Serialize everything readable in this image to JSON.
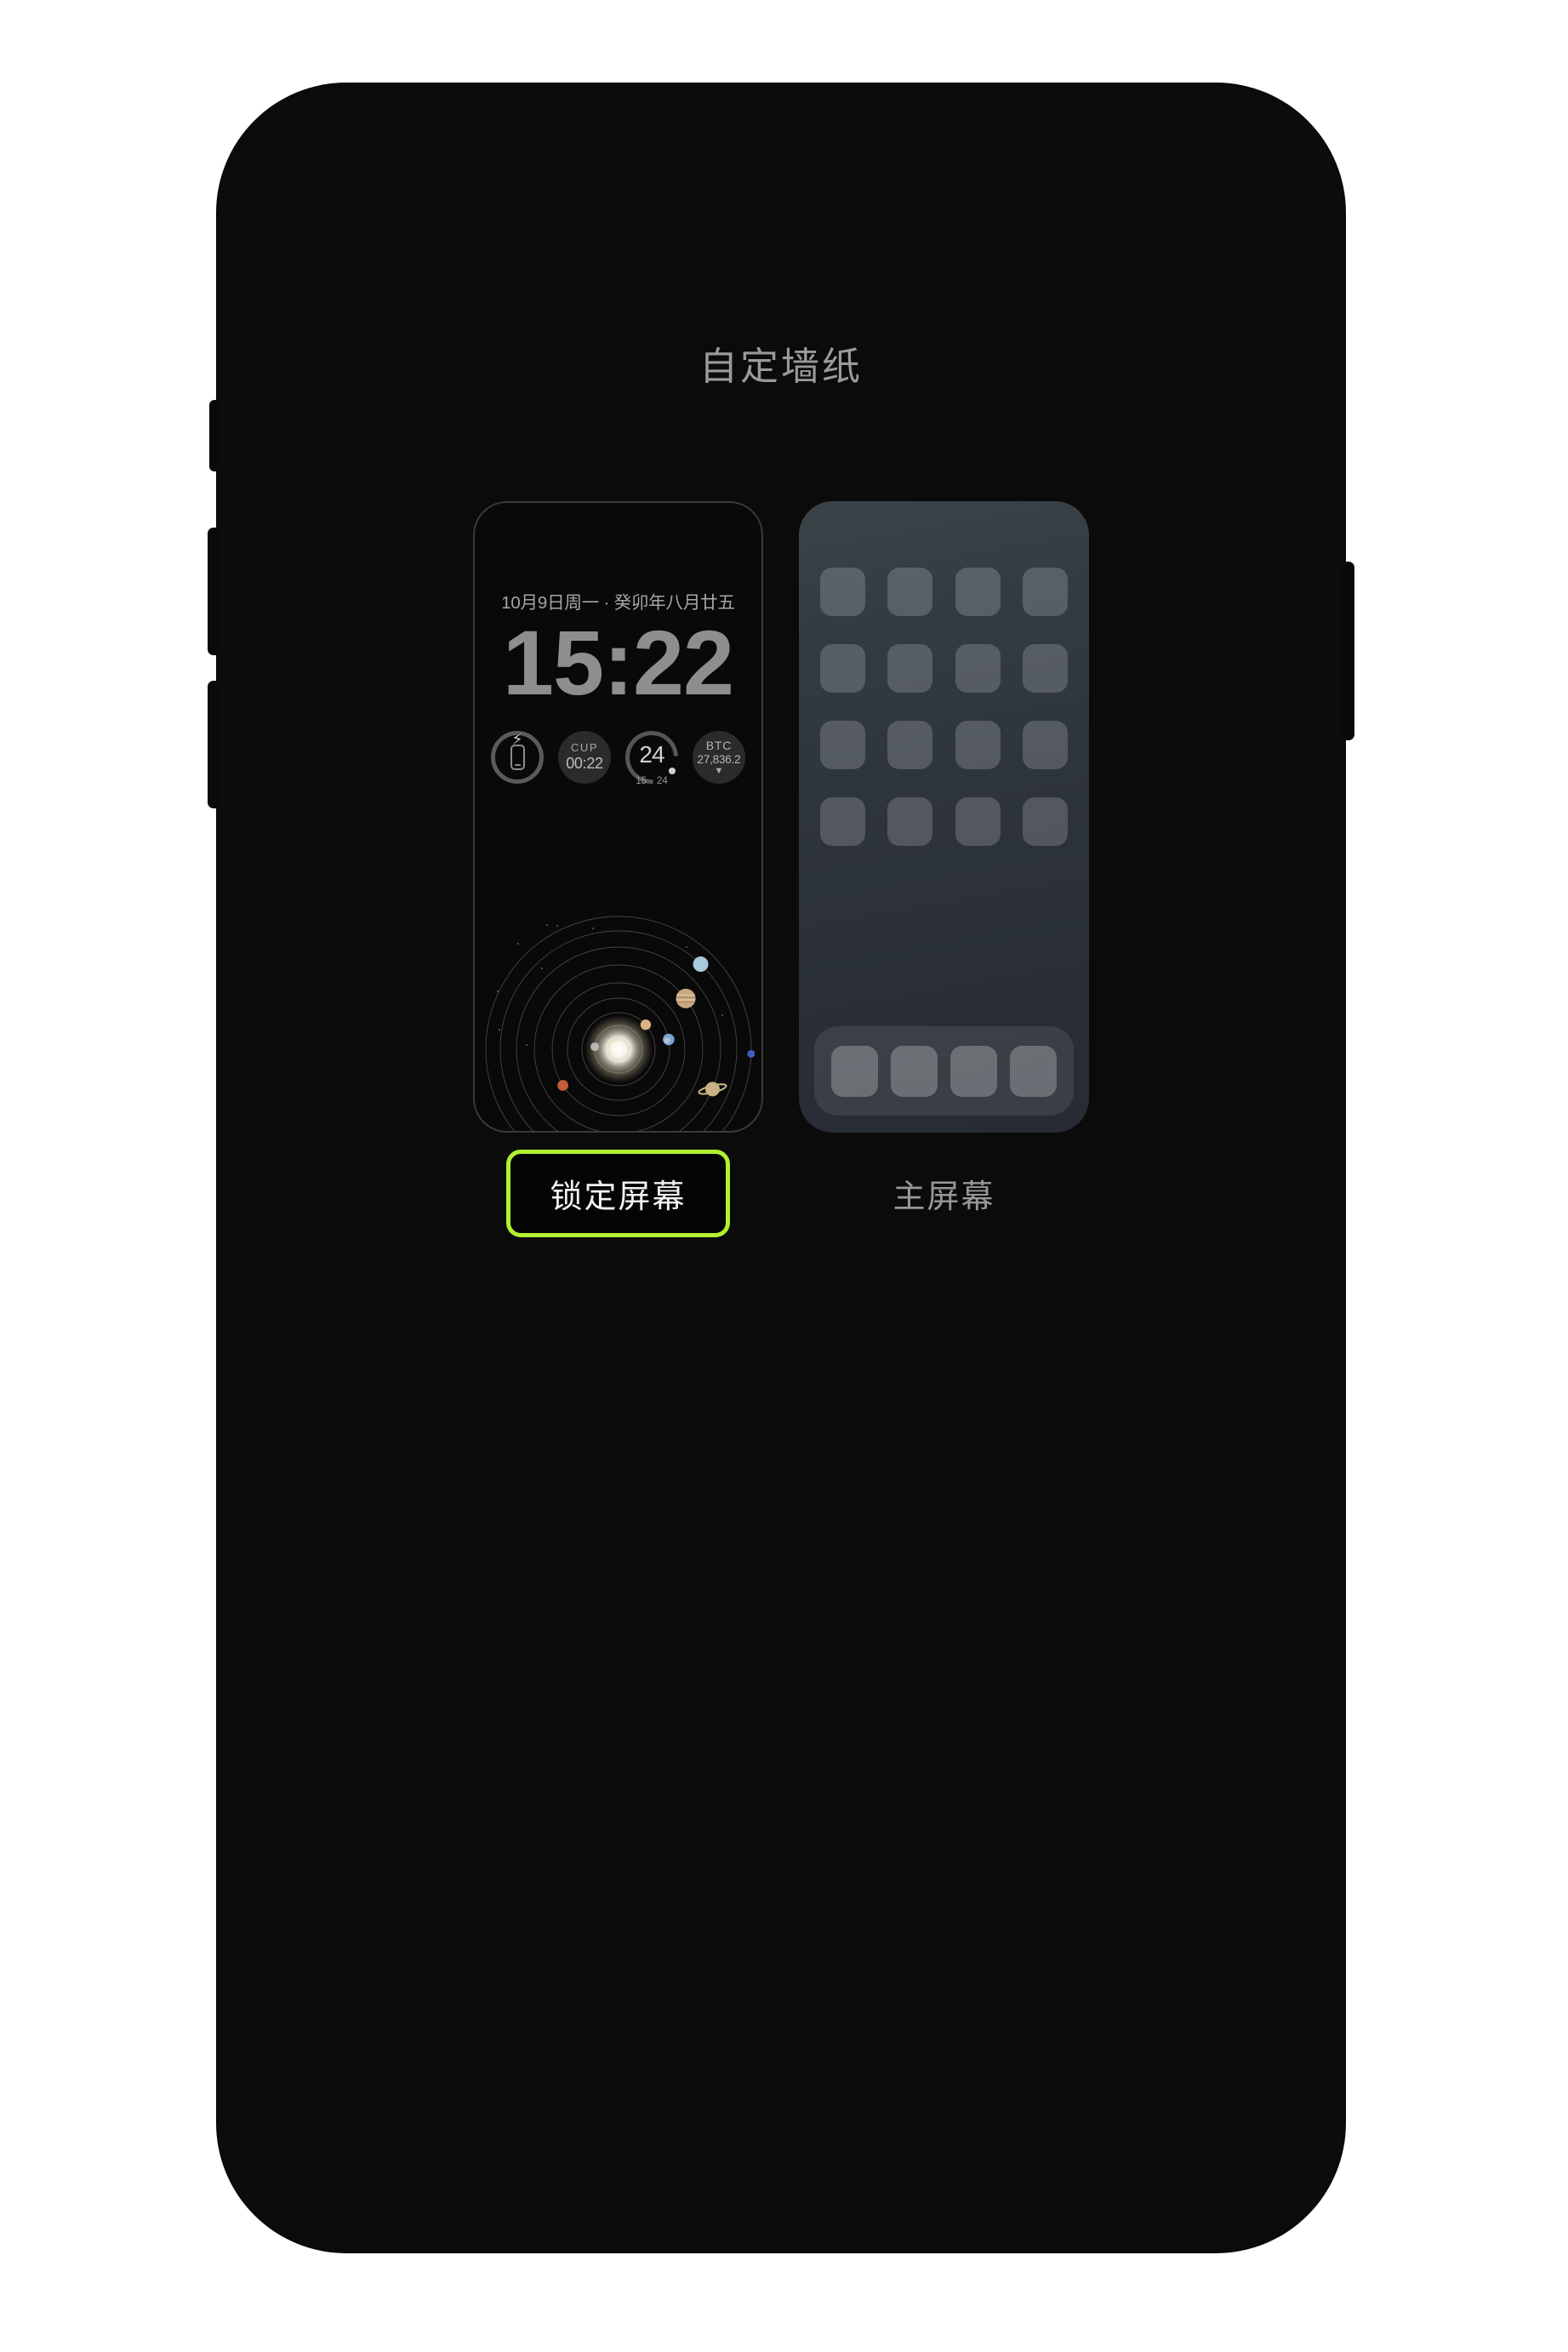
{
  "page": {
    "title": "自定墙纸"
  },
  "lock_screen": {
    "date": "10月9日周一 · 癸卯年八月廿五",
    "time": "15:22",
    "label": "锁定屏幕",
    "highlight_color": "#b1f030",
    "widgets": [
      {
        "name": "battery-charging",
        "icon": "phone-battery-icon",
        "bolt": "⚡"
      },
      {
        "name": "cup-timer",
        "label": "CUP",
        "value": "00:22"
      },
      {
        "name": "temperature-gauge",
        "value": "24",
        "scale_low": "15",
        "scale_high": "24"
      },
      {
        "name": "bitcoin-price",
        "label": "BTC",
        "value": "27,836.2",
        "arrow": "▼"
      }
    ],
    "wallpaper": {
      "name": "solar-system",
      "star": "Sun",
      "planets": [
        {
          "name": "Mercury",
          "color": "#b9b7b3",
          "orbit": 1,
          "r": 5.0,
          "angle": 186
        },
        {
          "name": "Venus",
          "color": "#d9b283",
          "orbit": 2,
          "r": 6.2,
          "angle": -42
        },
        {
          "name": "Earth",
          "color": "#7aa5d6",
          "orbit": 3,
          "r": 6.8,
          "angle": -11
        },
        {
          "name": "Mars",
          "color": "#c05c3a",
          "orbit": 4,
          "r": 6.4,
          "angle": 147
        },
        {
          "name": "Jupiter",
          "color": "#c9a982",
          "orbit": 5,
          "r": 11.5,
          "angle": -37
        },
        {
          "name": "Saturn",
          "color": "#c8b183",
          "orbit": 6,
          "r": 8.5,
          "angle": 23
        },
        {
          "name": "Uranus",
          "color": "#a9c9de",
          "orbit": 7,
          "r": 9.0,
          "angle": -46
        },
        {
          "name": "Neptune",
          "color": "#3f5fc0",
          "orbit": 8,
          "r": 4.5,
          "angle": 2
        }
      ],
      "orbit_count": 8
    }
  },
  "home_screen": {
    "label": "主屏幕",
    "grid_rows": 4,
    "grid_cols": 4,
    "dock_items": 4
  }
}
